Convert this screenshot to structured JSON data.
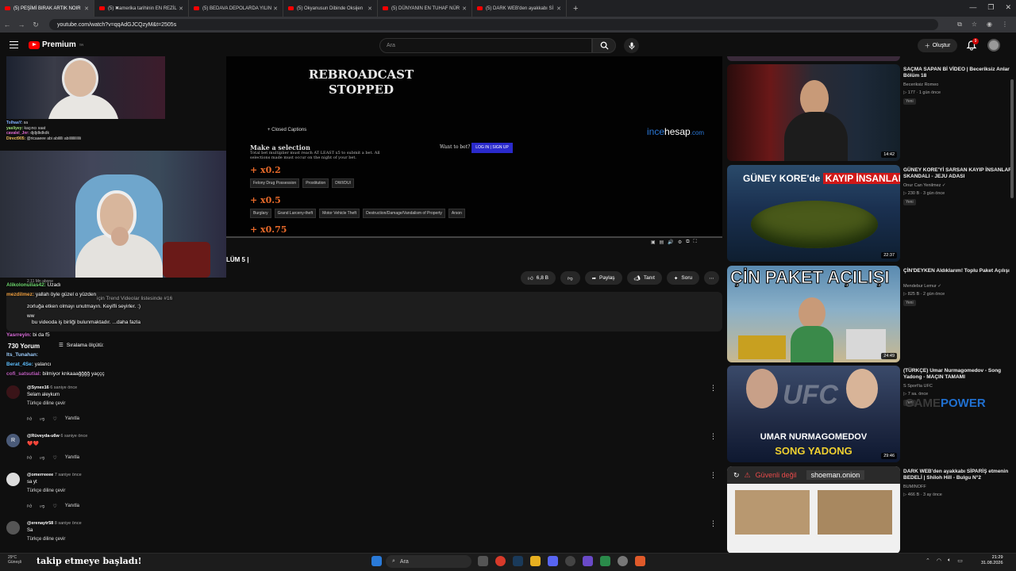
{
  "browser": {
    "tabs": [
      {
        "label": "(5) PEŞİMİ BIRAK ARTIK NOIR",
        "active": true
      },
      {
        "label": "(5) ✖amerika tarihinin EN REZİL",
        "active": false
      },
      {
        "label": "(5) BEDAVA DEPOLARDA YILIN",
        "active": false
      },
      {
        "label": "(5) Okyanusun Dibinde Oksijen",
        "active": false
      },
      {
        "label": "(5) DÜNYANIN EN TUHAF NÜR",
        "active": false
      },
      {
        "label": "(5) DARK WEB'den ayakkabı Sİ",
        "active": false
      }
    ],
    "new_tab": "+",
    "url": "youtube.com/watch?v=qqAdGJCQzyM&t=2505s"
  },
  "header": {
    "logo_text": "Premium",
    "logo_sup": "TR",
    "search_placeholder": "Ara",
    "create_label": "Oluştur",
    "notif_count": "9"
  },
  "video": {
    "rebroadcast": "REBROADCAST STOPPED",
    "closed_captions": "+ Closed Captions",
    "make_selection": "Make a selection",
    "selection_sub": "Total bet multiplier must reach AT LEAST x5 to submit a bet. All selections made must occur on the night of your bet.",
    "want_to_bet": "Want to bet?",
    "login_btn": "LOG IN | SIGN UP",
    "multipliers": [
      "+ x0.2",
      "+ x0.5",
      "+ x0.75"
    ],
    "chips_row1": [
      "Felony Drug Possession",
      "Prostitution",
      "DWI/DUI"
    ],
    "chips_row2": [
      "Burglary",
      "Grand Larceny-theft",
      "Motor Vehicle Theft",
      "Destruction/Damage/Vandalism of Property",
      "Arson"
    ],
    "sponsor_brand_a": "ince",
    "sponsor_brand_b": "hesap",
    "sponsor_tld": ".com",
    "title_partial": "LÜM 5 |",
    "channel_subs": "2,11 Mn abone"
  },
  "stream_chat_mini": [
    {
      "user": "TolhaaY:",
      "text": "sa"
    },
    {
      "user": "yasliyey:",
      "text": "kaçıncı saat"
    },
    {
      "user": "cavalel_Jnr:",
      "text": "djdjdkdkdk"
    },
    {
      "user": "Direct905:",
      "text": "@ricaaeee abi abililli abililililililii"
    }
  ],
  "actions": {
    "like_count": "6,8 B",
    "share": "Paylaş",
    "remix": "Tanıt",
    "ask": "Soru"
  },
  "overlay_chat": [
    {
      "user": "Alikolonuilas42:",
      "text": "Uzadı"
    },
    {
      "user": "mezdilmez:",
      "text": "yallah öyle güzel o yüzden"
    },
    {
      "user": "",
      "text": "için Trend Videolar listesinde #16"
    },
    {
      "user": "",
      "text": "zorluğa etken olmayı unutmayın. Keyifli seyirler. :)"
    },
    {
      "user": "",
      "text": "ww"
    },
    {
      "user": "",
      "text": "bu videoda iş birliği bulunmaktadır.  ...daha fazla"
    },
    {
      "user": "Yasrreyin:",
      "text": "bi da f5"
    },
    {
      "user": "lts_Tunahan:",
      "text": ""
    },
    {
      "user": "Berat_4Se:",
      "text": "yalancı"
    },
    {
      "user": "cofi_satsutial:",
      "text": "bilmiyor knkaaağğğğ yaççç"
    }
  ],
  "comments_section": {
    "count": "730 Yorum",
    "sort_label": "Sıralama ölçütü:"
  },
  "comments": [
    {
      "avatar": "",
      "user": "@Synex16",
      "time": "6 saniye önce",
      "text": "Selam aleykum",
      "translate": "Türkçe diline çevir",
      "reply": "Yanıtla"
    },
    {
      "avatar": "R",
      "user": "@Rüveyda-u6w",
      "time": "6 saniye önce",
      "text": "❤️❤️",
      "translate": "",
      "reply": "Yanıtla"
    },
    {
      "avatar": "",
      "user": "@omerreeee",
      "time": "7 saniye önce",
      "text": "sa yt",
      "translate": "Türkçe diline çevir",
      "reply": "Yanıtla"
    },
    {
      "avatar": "",
      "user": "@erenaytr58",
      "time": "8 saniye önce",
      "text": "Sa",
      "translate": "Türkçe diline çevir",
      "reply": ""
    }
  ],
  "sidebar": [
    {
      "title": "SAÇMA SAPAN Bİ VİDEO | Beceriksiz Anlar Bölüm 18",
      "channel": "Beceriksiz Romeo",
      "meta": "▷ 177 · 1 gün önce",
      "badge": "Yeni",
      "duration": "14:42"
    },
    {
      "title": "GÜNEY KORE'Yİ SARSAN KAYIP İNSANLAR SKANDALI - JEJU ADASI",
      "channel": "Onur Can Yenilmez ✓",
      "meta": "▷ 230 B · 3 gün önce",
      "badge": "Yeni",
      "duration": "22:37",
      "thumb_text_a": "GÜNEY KORE'de",
      "thumb_text_b": "KAYIP İNSANLAR"
    },
    {
      "title": "ÇİN'DEYKEN Aldıklarım! Toplu Paket Açılışı",
      "channel": "Mendebur Lemur ✓",
      "meta": "▷ 825 B · 2 gün önce",
      "badge": "Yeni",
      "duration": "24:49",
      "thumb_text_a": "ÇİN PAKET AÇILIŞI"
    },
    {
      "title": "(TÜRKÇE) Umar Nurmagomedov - Song Yadong - MAÇIN TAMAMI",
      "channel": "S Sport'ta UFC",
      "meta": "▷ 7 sa. önce",
      "badge": "Yeni",
      "duration": "29:46",
      "thumb_text_a": "UMAR NURMAGOMEDOV",
      "thumb_text_b": "SONG YADONG",
      "thumb_text_c": "UFC"
    },
    {
      "title": "DARK WEB'den ayakkabı SİPARİŞ etmenin BEDELİ | Shiloh Hill - Bulgu N°2",
      "channel": "BUMINOFF",
      "meta": "▷ 466 B · 3 ay önce",
      "badge": "",
      "duration": "",
      "thumb_text_a": "Güvenli değil",
      "thumb_text_b": "shoeman.onion"
    }
  ],
  "overlay_brand": {
    "a": "GAME",
    "b": "POWER"
  },
  "taskbar": {
    "follow_text": "takip etmeye başladı!",
    "weather": "29°C",
    "weather_sub": "Güneşli",
    "search": "Ara",
    "time": "21:29",
    "date": "31.08.2026"
  },
  "colors": {
    "yt_red": "#ff0000",
    "accent_blue": "#2a78d8",
    "bet_orange": "#e86a2a"
  }
}
